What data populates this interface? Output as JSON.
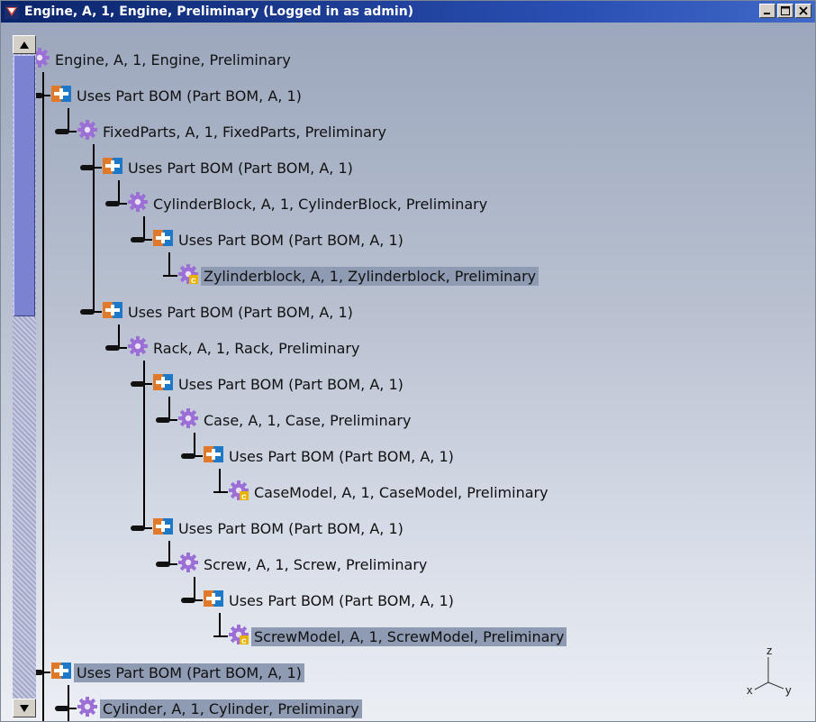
{
  "window": {
    "title": "Engine, A, 1, Engine, Preliminary (Logged in as admin)"
  },
  "tree": [
    {
      "label": "Engine, A, 1, Engine, Preliminary",
      "icon": "gear-icon"
    },
    {
      "label": "Uses Part BOM (Part BOM, A, 1)",
      "icon": "part-bom-icon"
    },
    {
      "label": "FixedParts, A, 1, FixedParts, Preliminary",
      "icon": "gear-icon"
    },
    {
      "label": "Uses Part BOM (Part BOM, A, 1)",
      "icon": "part-bom-icon"
    },
    {
      "label": "CylinderBlock, A, 1, CylinderBlock, Preliminary",
      "icon": "gear-icon"
    },
    {
      "label": "Uses Part BOM (Part BOM, A, 1)",
      "icon": "part-bom-icon"
    },
    {
      "label": "Zylinderblock, A, 1, Zylinderblock, Preliminary",
      "icon": "cad-model-icon"
    },
    {
      "label": "Uses Part BOM (Part BOM, A, 1)",
      "icon": "part-bom-icon"
    },
    {
      "label": "Rack, A, 1, Rack, Preliminary",
      "icon": "gear-icon"
    },
    {
      "label": "Uses Part BOM (Part BOM, A, 1)",
      "icon": "part-bom-icon"
    },
    {
      "label": "Case, A, 1, Case, Preliminary",
      "icon": "gear-icon"
    },
    {
      "label": "Uses Part BOM (Part BOM, A, 1)",
      "icon": "part-bom-icon"
    },
    {
      "label": "CaseModel, A, 1, CaseModel, Preliminary",
      "icon": "cad-model-icon"
    },
    {
      "label": "Uses Part BOM (Part BOM, A, 1)",
      "icon": "part-bom-icon"
    },
    {
      "label": "Screw, A, 1, Screw, Preliminary",
      "icon": "gear-icon"
    },
    {
      "label": "Uses Part BOM (Part BOM, A, 1)",
      "icon": "part-bom-icon"
    },
    {
      "label": "ScrewModel, A, 1, ScrewModel, Preliminary",
      "icon": "cad-model-icon"
    },
    {
      "label": "Uses Part BOM (Part BOM, A, 1)",
      "icon": "part-bom-icon"
    },
    {
      "label": "Cylinder, A, 1, Cylinder, Preliminary",
      "icon": "gear-icon"
    }
  ],
  "axis": {
    "z_label": "z",
    "x_label": "x",
    "y_label": "y"
  },
  "colors": {
    "title_bar": "#0a246a",
    "gear": "#9b6fd6",
    "bom_orange": "#e07a2a",
    "bom_blue": "#1e78c8",
    "model_badge": "#e8b400",
    "selection": "#8f9bb3"
  }
}
